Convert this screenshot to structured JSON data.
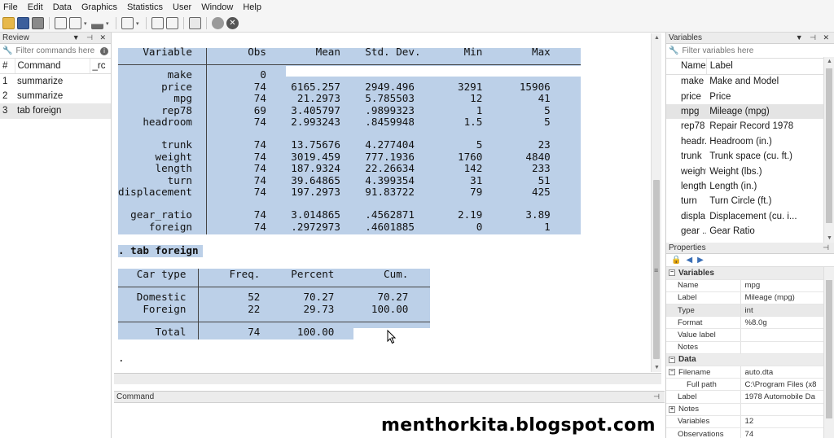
{
  "menu": [
    "File",
    "Edit",
    "Data",
    "Graphics",
    "Statistics",
    "User",
    "Window",
    "Help"
  ],
  "review": {
    "title": "Review",
    "filter_placeholder": "Filter commands here",
    "col_num": "#",
    "col_command": "Command",
    "col_rc": "_rc",
    "rows": [
      {
        "n": "1",
        "cmd": "summarize"
      },
      {
        "n": "2",
        "cmd": "summarize"
      },
      {
        "n": "3",
        "cmd": "tab foreign"
      }
    ]
  },
  "results": {
    "summary_lines": [
      "    Variable         Obs        Mean    Std. Dev.       Min        Max",
      "",
      "        make           0",
      "       price          74    6165.257    2949.496       3291      15906",
      "         mpg          74     21.2973    5.785503         12         41",
      "       rep78          69    3.405797    .9899323          1          5",
      "    headroom          74    2.993243    .8459948        1.5          5",
      "",
      "       trunk          74    13.75676    4.277404          5         23",
      "      weight          74    3019.459    777.1936       1760       4840",
      "      length          74    187.9324    22.26634        142        233",
      "        turn          74    39.64865    4.399354         31         51",
      "displacement          74    197.2973    91.83722         79        425",
      "",
      "  gear_ratio          74    3.014865    .4562871       2.19       3.89",
      "     foreign          74    .2972973    .4601885          0          1"
    ],
    "command_echo": ". tab foreign",
    "tab_lines": [
      "   Car type       Freq.     Percent        Cum.",
      "",
      "   Domestic          52       70.27       70.27",
      "    Foreign          22       29.73      100.00",
      "",
      "      Total          74      100.00"
    ],
    "prompt": "."
  },
  "command_panel": {
    "title": "Command"
  },
  "variables": {
    "title": "Variables",
    "filter_placeholder": "Filter variables here",
    "col_name": "Name",
    "col_label": "Label",
    "rows": [
      {
        "name": "make",
        "label": "Make and Model"
      },
      {
        "name": "price",
        "label": "Price"
      },
      {
        "name": "mpg",
        "label": "Mileage (mpg)"
      },
      {
        "name": "rep78",
        "label": "Repair Record 1978"
      },
      {
        "name": "headr...",
        "label": "Headroom (in.)"
      },
      {
        "name": "trunk",
        "label": "Trunk space (cu. ft.)"
      },
      {
        "name": "weight",
        "label": "Weight (lbs.)"
      },
      {
        "name": "length",
        "label": "Length (in.)"
      },
      {
        "name": "turn",
        "label": "Turn Circle (ft.)"
      },
      {
        "name": "displa...",
        "label": "Displacement (cu. i..."
      },
      {
        "name": "gear ...",
        "label": "Gear Ratio"
      }
    ]
  },
  "properties": {
    "title": "Properties",
    "sec_variables": "Variables",
    "var_rows": [
      {
        "k": "Name",
        "v": "mpg"
      },
      {
        "k": "Label",
        "v": "Mileage (mpg)"
      },
      {
        "k": "Type",
        "v": "int"
      },
      {
        "k": "Format",
        "v": "%8.0g"
      },
      {
        "k": "Value label",
        "v": ""
      },
      {
        "k": "Notes",
        "v": ""
      }
    ],
    "sec_data": "Data",
    "data_filename": {
      "k": "Filename",
      "v": "auto.dta"
    },
    "data_fullpath": {
      "k": "Full path",
      "v": "C:\\Program Files (x8"
    },
    "data_label": {
      "k": "Label",
      "v": "1978 Automobile Da"
    },
    "data_notes": {
      "k": "Notes",
      "v": ""
    },
    "data_variables": {
      "k": "Variables",
      "v": "12"
    },
    "data_observations": {
      "k": "Observations",
      "v": "74"
    }
  },
  "watermark": "menthorkita.blogspot.com",
  "colors": {
    "highlight": "#bcd0e8",
    "panel": "#ececec"
  }
}
